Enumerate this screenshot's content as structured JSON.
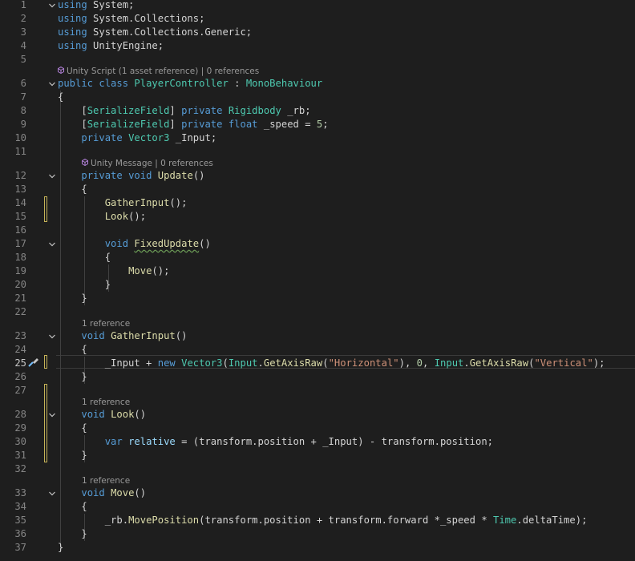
{
  "editor": {
    "active_line": "25",
    "lines": [
      {
        "n": "1",
        "t": [
          [
            "using",
            "kw"
          ],
          [
            " System;",
            "pl"
          ]
        ]
      },
      {
        "n": "2",
        "t": [
          [
            "using",
            "kw"
          ],
          [
            " System.Collections;",
            "pl"
          ]
        ]
      },
      {
        "n": "3",
        "t": [
          [
            "using",
            "kw"
          ],
          [
            " System.Collections.Generic;",
            "pl"
          ]
        ]
      },
      {
        "n": "4",
        "t": [
          [
            "using",
            "kw"
          ],
          [
            " UnityEngine;",
            "pl"
          ]
        ]
      },
      {
        "n": "5",
        "t": []
      },
      {
        "n": "6",
        "t": [
          [
            "public",
            "kw"
          ],
          [
            " ",
            "pl"
          ],
          [
            "class",
            "kw"
          ],
          [
            " ",
            "pl"
          ],
          [
            "PlayerController",
            "ty"
          ],
          [
            " : ",
            "pl"
          ],
          [
            "MonoBehaviour",
            "ty"
          ]
        ]
      },
      {
        "n": "7",
        "t": [
          [
            "{",
            "pl"
          ]
        ]
      },
      {
        "n": "8",
        "t": [
          [
            "    [",
            "pl"
          ],
          [
            "SerializeField",
            "ty"
          ],
          [
            "] ",
            "pl"
          ],
          [
            "private",
            "kw"
          ],
          [
            " ",
            "pl"
          ],
          [
            "Rigidbody",
            "ty"
          ],
          [
            " _rb;",
            "pl"
          ]
        ]
      },
      {
        "n": "9",
        "t": [
          [
            "    [",
            "pl"
          ],
          [
            "SerializeField",
            "ty"
          ],
          [
            "] ",
            "pl"
          ],
          [
            "private",
            "kw"
          ],
          [
            " ",
            "pl"
          ],
          [
            "float",
            "kw"
          ],
          [
            " _speed = ",
            "pl"
          ],
          [
            "5",
            "nu"
          ],
          [
            ";",
            "pl"
          ]
        ]
      },
      {
        "n": "10",
        "t": [
          [
            "    ",
            "pl"
          ],
          [
            "private",
            "kw"
          ],
          [
            " ",
            "pl"
          ],
          [
            "Vector3",
            "ty"
          ],
          [
            " _Input;",
            "pl"
          ]
        ]
      },
      {
        "n": "11",
        "t": []
      },
      {
        "n": "12",
        "t": [
          [
            "    ",
            "pl"
          ],
          [
            "private",
            "kw"
          ],
          [
            " ",
            "pl"
          ],
          [
            "void",
            "kw"
          ],
          [
            " ",
            "pl"
          ],
          [
            "Update",
            "fn"
          ],
          [
            "()",
            "pl"
          ]
        ]
      },
      {
        "n": "13",
        "t": [
          [
            "    {",
            "pl"
          ]
        ]
      },
      {
        "n": "14",
        "t": [
          [
            "        ",
            "pl"
          ],
          [
            "GatherInput",
            "fn"
          ],
          [
            "();",
            "pl"
          ]
        ]
      },
      {
        "n": "15",
        "t": [
          [
            "        ",
            "pl"
          ],
          [
            "Look",
            "fn"
          ],
          [
            "();",
            "pl"
          ]
        ]
      },
      {
        "n": "16",
        "t": []
      },
      {
        "n": "17",
        "t": [
          [
            "        ",
            "pl"
          ],
          [
            "void",
            "kw"
          ],
          [
            " ",
            "pl"
          ],
          [
            "FixedUpdate",
            "fn",
            "squiggle"
          ],
          [
            "()",
            "pl"
          ]
        ]
      },
      {
        "n": "18",
        "t": [
          [
            "        {",
            "pl"
          ]
        ]
      },
      {
        "n": "19",
        "t": [
          [
            "            ",
            "pl"
          ],
          [
            "Move",
            "fn"
          ],
          [
            "();",
            "pl"
          ]
        ]
      },
      {
        "n": "20",
        "t": [
          [
            "        }",
            "pl"
          ]
        ]
      },
      {
        "n": "21",
        "t": [
          [
            "    }",
            "pl"
          ]
        ]
      },
      {
        "n": "22",
        "t": []
      },
      {
        "n": "23",
        "t": [
          [
            "    ",
            "pl"
          ],
          [
            "void",
            "kw"
          ],
          [
            " ",
            "pl"
          ],
          [
            "GatherInput",
            "fn"
          ],
          [
            "()",
            "pl"
          ]
        ]
      },
      {
        "n": "24",
        "t": [
          [
            "    {",
            "pl"
          ]
        ]
      },
      {
        "n": "25",
        "t": [
          [
            "        _Input + ",
            "pl"
          ],
          [
            "new",
            "kw"
          ],
          [
            " ",
            "pl"
          ],
          [
            "Vector3",
            "ty"
          ],
          [
            "(",
            "pl"
          ],
          [
            "Input",
            "ty"
          ],
          [
            ".",
            "pl"
          ],
          [
            "GetAxisRaw",
            "fn"
          ],
          [
            "(",
            "pl"
          ],
          [
            "\"Horizontal\"",
            "st"
          ],
          [
            "), ",
            "pl"
          ],
          [
            "0",
            "nu"
          ],
          [
            ", ",
            "pl"
          ],
          [
            "Input",
            "ty"
          ],
          [
            ".",
            "pl"
          ],
          [
            "GetAxisRaw",
            "fn"
          ],
          [
            "(",
            "pl"
          ],
          [
            "\"Vertical\"",
            "st"
          ],
          [
            ");",
            "pl"
          ]
        ]
      },
      {
        "n": "26",
        "t": [
          [
            "    }",
            "pl"
          ]
        ]
      },
      {
        "n": "27",
        "t": []
      },
      {
        "n": "28",
        "t": [
          [
            "    ",
            "pl"
          ],
          [
            "void",
            "kw"
          ],
          [
            " ",
            "pl"
          ],
          [
            "Look",
            "fn"
          ],
          [
            "()",
            "pl"
          ]
        ]
      },
      {
        "n": "29",
        "t": [
          [
            "    {",
            "pl"
          ]
        ]
      },
      {
        "n": "30",
        "t": [
          [
            "        ",
            "pl"
          ],
          [
            "var",
            "kw"
          ],
          [
            " ",
            "pl"
          ],
          [
            "relative",
            "va"
          ],
          [
            " = (transform.position + _Input) - transform.position;",
            "pl"
          ]
        ]
      },
      {
        "n": "31",
        "t": [
          [
            "    }",
            "pl"
          ]
        ]
      },
      {
        "n": "32",
        "t": []
      },
      {
        "n": "33",
        "t": [
          [
            "    ",
            "pl"
          ],
          [
            "void",
            "kw"
          ],
          [
            " ",
            "pl"
          ],
          [
            "Move",
            "fn"
          ],
          [
            "()",
            "pl"
          ]
        ]
      },
      {
        "n": "34",
        "t": [
          [
            "    {",
            "pl"
          ]
        ]
      },
      {
        "n": "35",
        "t": [
          [
            "        _rb.",
            "pl"
          ],
          [
            "MovePosition",
            "fn"
          ],
          [
            "(transform.position + transform.forward *_speed * ",
            "pl"
          ],
          [
            "Time",
            "ty"
          ],
          [
            ".deltaTime);",
            "pl"
          ]
        ]
      },
      {
        "n": "36",
        "t": [
          [
            "    }",
            "pl"
          ]
        ]
      },
      {
        "n": "37",
        "t": [
          [
            "}",
            "pl"
          ]
        ]
      }
    ],
    "codelens": [
      {
        "after": "5",
        "text": "Unity Script (1 asset reference) | 0 references",
        "icon": "unity-cube-icon"
      },
      {
        "after": "11",
        "text": "Unity Message | 0 references",
        "icon": "unity-cube-icon"
      },
      {
        "after": "22",
        "text": "1 reference",
        "icon": ""
      },
      {
        "after": "27",
        "text": "1 reference",
        "icon": ""
      },
      {
        "after": "32",
        "text": "1 reference",
        "icon": ""
      }
    ],
    "fold_lines": [
      "1",
      "6",
      "12",
      "17",
      "23",
      "28",
      "33"
    ],
    "icons": {
      "fold": "chevron-down-icon",
      "quick_action": "screwdriver-brush-icon"
    },
    "colors": {
      "background": "#1e1e1e",
      "keyword": "#569cd6",
      "type": "#4ec9b0",
      "method": "#dcdcaa",
      "string": "#ce9178",
      "number": "#b5cea8",
      "variable": "#9cdcfe",
      "text": "#d4d4d4",
      "line_number": "#858585"
    }
  }
}
